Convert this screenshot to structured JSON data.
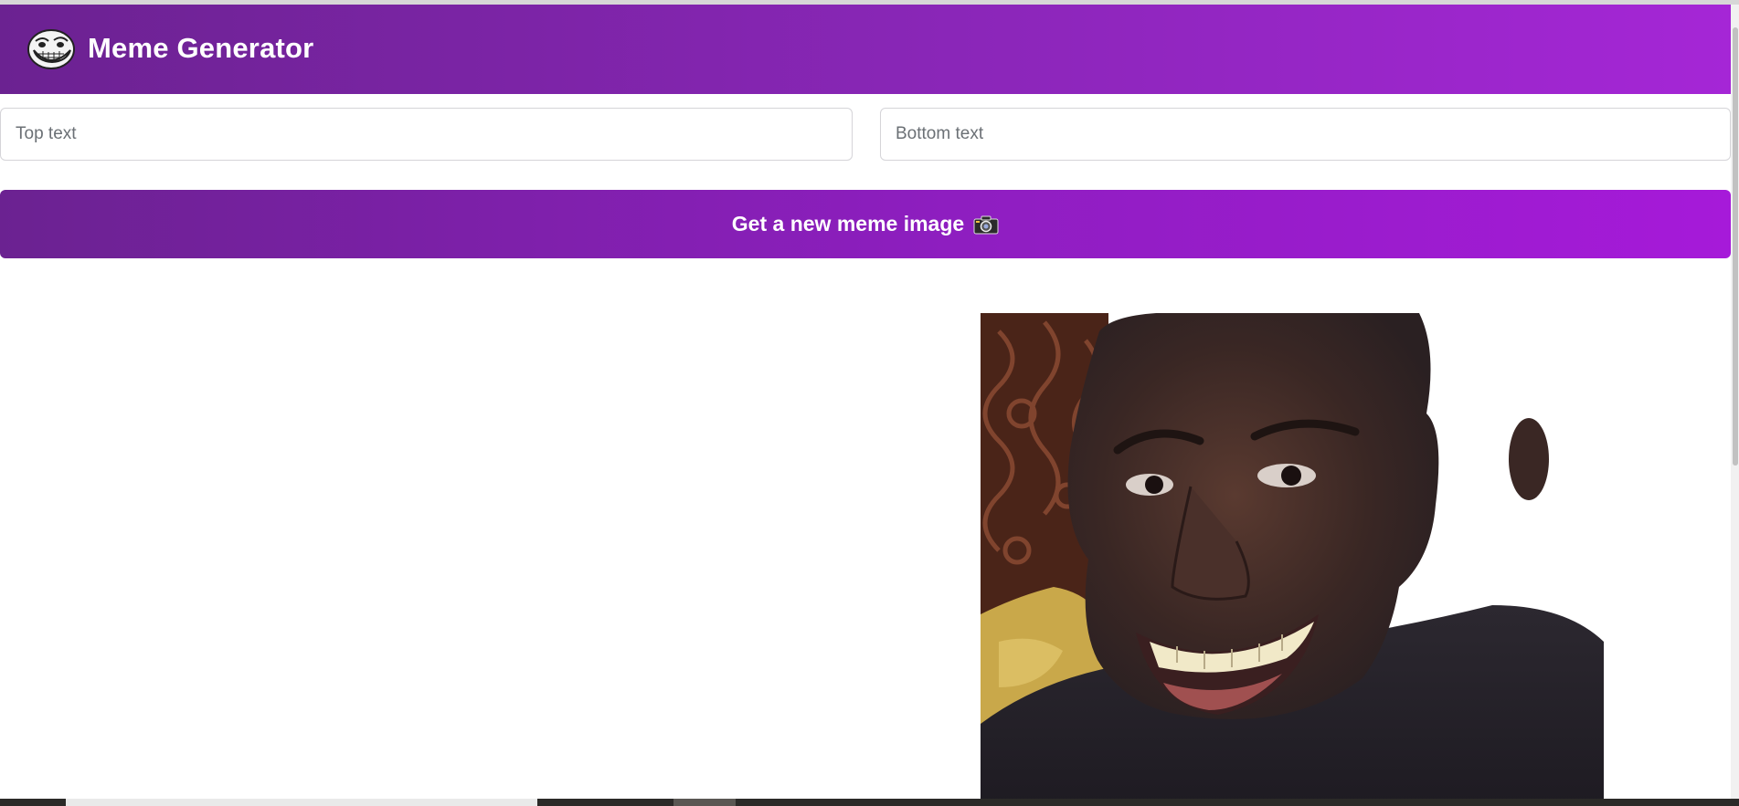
{
  "header": {
    "title": "Meme Generator",
    "logo_icon": "troll-face-icon",
    "gradient_start": "#6b2291",
    "gradient_end": "#a526d6"
  },
  "form": {
    "top_text_placeholder": "Top text",
    "top_text_value": "",
    "bottom_text_placeholder": "Bottom text",
    "bottom_text_value": "",
    "button_label": "Get a new meme image",
    "button_icon": "camera-icon"
  },
  "meme": {
    "image_icon": "meme-image-smiling-man"
  }
}
